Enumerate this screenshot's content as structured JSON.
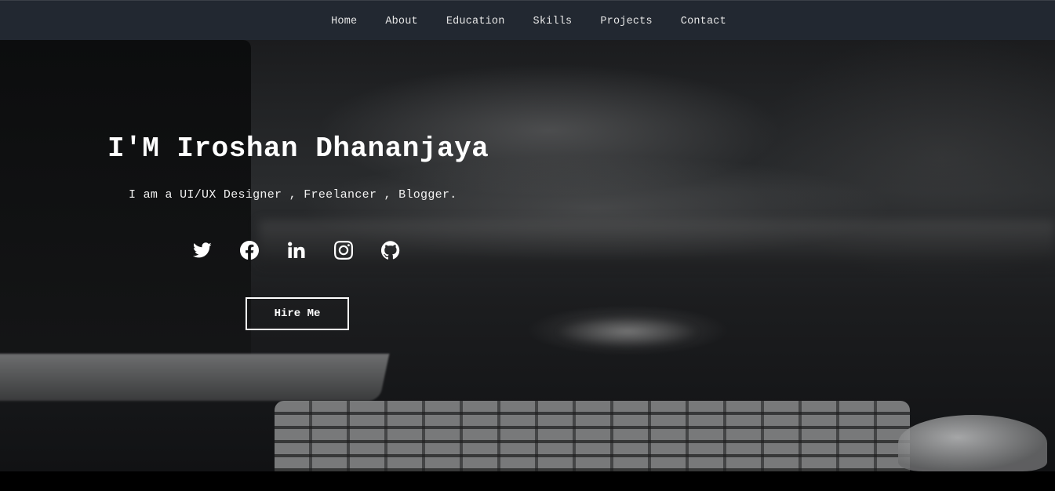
{
  "nav": {
    "items": [
      {
        "label": "Home"
      },
      {
        "label": "About"
      },
      {
        "label": "Education"
      },
      {
        "label": "Skills"
      },
      {
        "label": "Projects"
      },
      {
        "label": "Contact"
      }
    ]
  },
  "hero": {
    "title": "I'M Iroshan Dhananjaya",
    "subtitle": "I am a UI/UX Designer , Freelancer , Blogger.",
    "social_icons": [
      "twitter-icon",
      "facebook-icon",
      "linkedin-icon",
      "instagram-icon",
      "github-icon"
    ],
    "cta_label": "Hire Me"
  },
  "colors": {
    "navbar_bg": "#222831",
    "text": "#ffffff",
    "bottom_bar": "#000000"
  }
}
